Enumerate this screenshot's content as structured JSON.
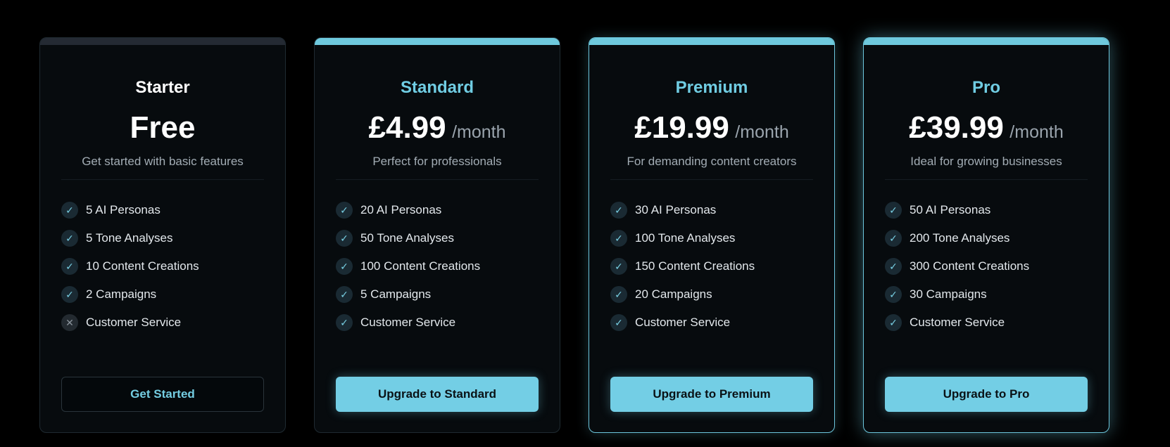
{
  "plans": [
    {
      "name": "Starter",
      "price": "Free",
      "period": "",
      "subtitle": "Get started with basic features",
      "features": [
        {
          "label": "5 AI Personas",
          "included": true
        },
        {
          "label": "5 Tone Analyses",
          "included": true
        },
        {
          "label": "10 Content Creations",
          "included": true
        },
        {
          "label": "2 Campaigns",
          "included": true
        },
        {
          "label": "Customer Service",
          "included": false
        }
      ],
      "button": "Get Started"
    },
    {
      "name": "Standard",
      "price": "£4.99",
      "period": "/month",
      "subtitle": "Perfect for professionals",
      "features": [
        {
          "label": "20 AI Personas",
          "included": true
        },
        {
          "label": "50 Tone Analyses",
          "included": true
        },
        {
          "label": "100 Content Creations",
          "included": true
        },
        {
          "label": "5 Campaigns",
          "included": true
        },
        {
          "label": "Customer Service",
          "included": true
        }
      ],
      "button": "Upgrade to Standard"
    },
    {
      "name": "Premium",
      "price": "£19.99",
      "period": "/month",
      "subtitle": "For demanding content creators",
      "features": [
        {
          "label": "30 AI Personas",
          "included": true
        },
        {
          "label": "100 Tone Analyses",
          "included": true
        },
        {
          "label": "150 Content Creations",
          "included": true
        },
        {
          "label": "20 Campaigns",
          "included": true
        },
        {
          "label": "Customer Service",
          "included": true
        }
      ],
      "button": "Upgrade to Premium"
    },
    {
      "name": "Pro",
      "price": "£39.99",
      "period": "/month",
      "subtitle": "Ideal for growing businesses",
      "features": [
        {
          "label": "50 AI Personas",
          "included": true
        },
        {
          "label": "200 Tone Analyses",
          "included": true
        },
        {
          "label": "300 Content Creations",
          "included": true
        },
        {
          "label": "30 Campaigns",
          "included": true
        },
        {
          "label": "Customer Service",
          "included": true
        }
      ],
      "button": "Upgrade to Pro"
    }
  ],
  "icons": {
    "included": "check-icon",
    "excluded": "x-icon"
  },
  "colors": {
    "background": "#000000",
    "card": "#070b0e",
    "accent": "#73cee5",
    "accent_text": "#70cde3"
  }
}
